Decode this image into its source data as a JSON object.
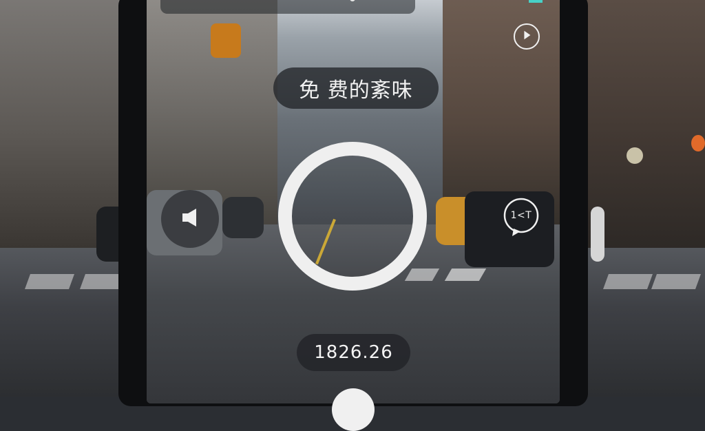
{
  "camera_ui": {
    "title": "免 费的紊味",
    "counter": "1826.26",
    "speed_label": "1<T"
  },
  "icons": {
    "timer": "timer-play-icon",
    "speaker": "speaker-icon",
    "speed": "speech-bubble-icon",
    "shutter": "shutter-ring"
  },
  "colors": {
    "overlay": "#232529",
    "foreground": "#efefef",
    "accent": "#47d1c7"
  }
}
